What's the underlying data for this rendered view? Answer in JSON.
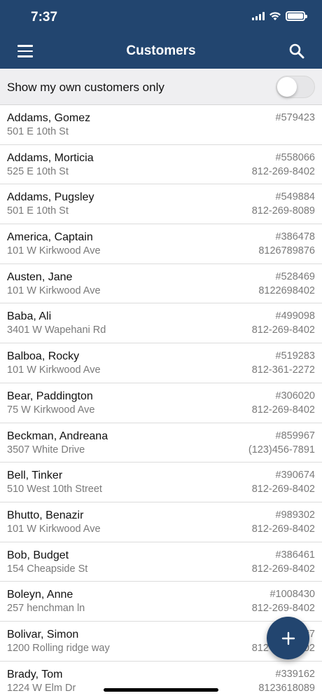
{
  "status_bar": {
    "time": "7:37"
  },
  "nav": {
    "title": "Customers",
    "menu_icon": "hamburger-menu-icon",
    "search_icon": "search-icon"
  },
  "filter": {
    "label": "Show my own customers only",
    "enabled": false
  },
  "customers": [
    {
      "name": "Addams, Gomez",
      "address": "501 E 10th St",
      "number": "#579423",
      "phone": ""
    },
    {
      "name": "Addams, Morticia",
      "address": "525 E 10th St",
      "number": "#558066",
      "phone": "812-269-8402"
    },
    {
      "name": "Addams, Pugsley",
      "address": "501 E 10th St",
      "number": "#549884",
      "phone": "812-269-8089"
    },
    {
      "name": "America, Captain",
      "address": "101 W Kirkwood Ave",
      "number": "#386478",
      "phone": "8126789876"
    },
    {
      "name": "Austen, Jane",
      "address": "101 W Kirkwood Ave",
      "number": "#528469",
      "phone": "8122698402"
    },
    {
      "name": "Baba, Ali",
      "address": "3401 W Wapehani Rd",
      "number": "#499098",
      "phone": "812-269-8402"
    },
    {
      "name": "Balboa, Rocky",
      "address": "101 W Kirkwood Ave",
      "number": "#519283",
      "phone": "812-361-2272"
    },
    {
      "name": "Bear, Paddington",
      "address": "75 W Kirkwood Ave",
      "number": "#306020",
      "phone": "812-269-8402"
    },
    {
      "name": "Beckman, Andreana",
      "address": "3507 White Drive",
      "number": "#859967",
      "phone": "(123)456-7891"
    },
    {
      "name": "Bell, Tinker",
      "address": "510 West 10th Street",
      "number": "#390674",
      "phone": "812-269-8402"
    },
    {
      "name": "Bhutto, Benazir",
      "address": "101 W Kirkwood Ave",
      "number": "#989302",
      "phone": "812-269-8402"
    },
    {
      "name": "Bob, Budget",
      "address": "154 Cheapside St",
      "number": "#386461",
      "phone": "812-269-8402"
    },
    {
      "name": "Boleyn, Anne",
      "address": "257 henchman ln",
      "number": "#1008430",
      "phone": "812-269-8402"
    },
    {
      "name": "Bolivar, Simon",
      "address": "1200 Rolling ridge way",
      "number": "#7",
      "phone": "812-269-8402"
    },
    {
      "name": "Brady, Tom",
      "address": "1224 W Elm Dr",
      "number": "#339162",
      "phone": "8123618089"
    }
  ],
  "fab": {
    "icon": "plus-icon"
  },
  "colors": {
    "header": "#22456f",
    "fab": "#22456f",
    "secondary_text": "#7a7a7a"
  }
}
